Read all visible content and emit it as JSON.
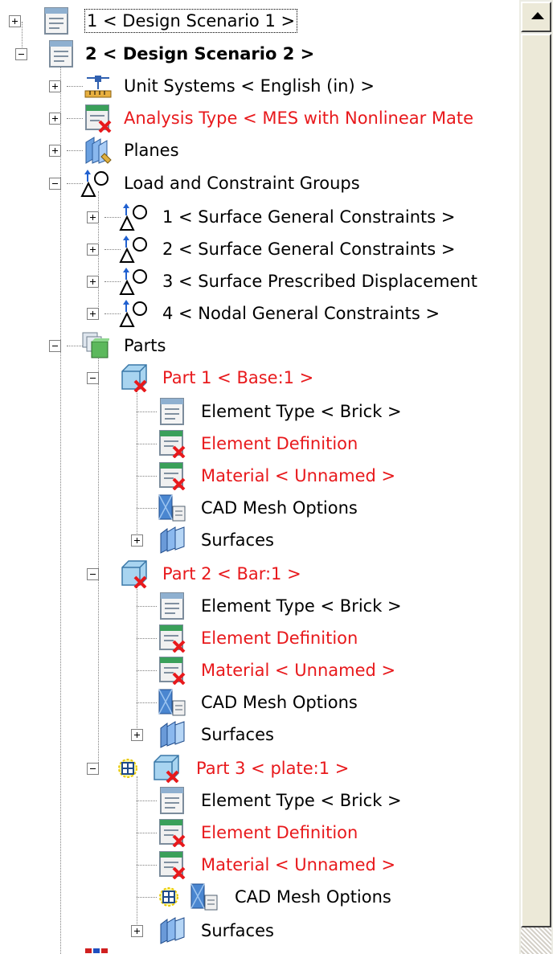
{
  "tree": {
    "scenario1": {
      "label": "1 < Design Scenario 1 >",
      "icon": "scenario-icon"
    },
    "scenario2": {
      "label": "2 < Design Scenario 2 >",
      "icon": "scenario-icon",
      "unit_systems": "Unit Systems < English (in) >",
      "analysis_type": "Analysis Type < MES with Nonlinear Mate",
      "planes": "Planes",
      "load_groups": {
        "label": "Load and Constraint Groups",
        "items": [
          "1 < Surface General Constraints >",
          "2 < Surface General Constraints >",
          "3 < Surface Prescribed Displacement",
          "4 < Nodal General Constraints >"
        ]
      },
      "parts": {
        "label": "Parts",
        "items": [
          {
            "label": "Part 1 < Base:1 >",
            "element_type": "Element Type < Brick >",
            "element_definition": "Element Definition",
            "material": "Material < Unnamed >",
            "mesh_options": "CAD Mesh Options",
            "surfaces": "Surfaces"
          },
          {
            "label": "Part 2 < Bar:1 >",
            "element_type": "Element Type < Brick >",
            "element_definition": "Element Definition",
            "material": "Material < Unnamed >",
            "mesh_options": "CAD Mesh Options",
            "surfaces": "Surfaces"
          },
          {
            "label": "Part 3 < plate:1 >",
            "element_type": "Element Type < Brick >",
            "element_definition": "Element Definition",
            "material": "Material < Unnamed >",
            "mesh_options": "CAD Mesh Options",
            "surfaces": "Surfaces"
          }
        ]
      }
    }
  },
  "colors": {
    "error_text": "#e8191c",
    "normal_text": "#000000",
    "scrollbar_face": "#ece9d8"
  }
}
